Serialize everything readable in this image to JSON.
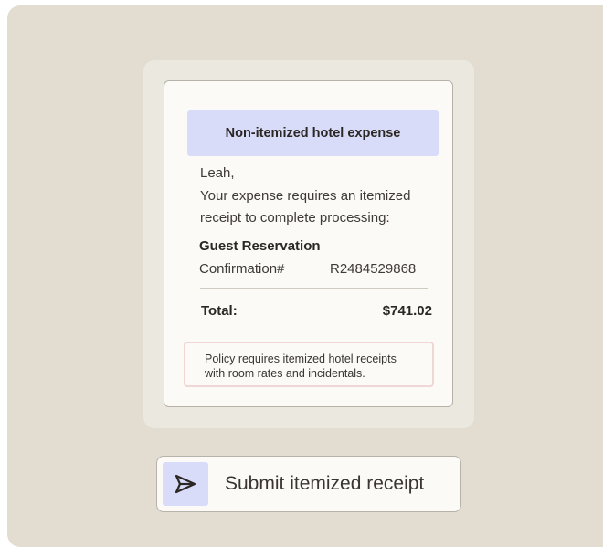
{
  "receipt": {
    "banner_title": "Non-itemized hotel expense",
    "greeting": "Leah,",
    "message_line1": "Your expense requires an itemized",
    "message_line2": "receipt to complete processing:",
    "section_title": "Guest Reservation",
    "confirmation_label": "Confirmation#",
    "confirmation_value": "R2484529868",
    "total_label": "Total:",
    "total_value": "$741.02",
    "policy_line1": "Policy requires itemized hotel receipts",
    "policy_line2": "with room rates and incidentals."
  },
  "action": {
    "submit_label": "Submit itemized receipt",
    "icon": "send-icon"
  },
  "colors": {
    "background": "#e2ddd0",
    "card": "#fbfaf6",
    "accent": "#d9dcf9",
    "policy_border": "#f1d6d6"
  }
}
